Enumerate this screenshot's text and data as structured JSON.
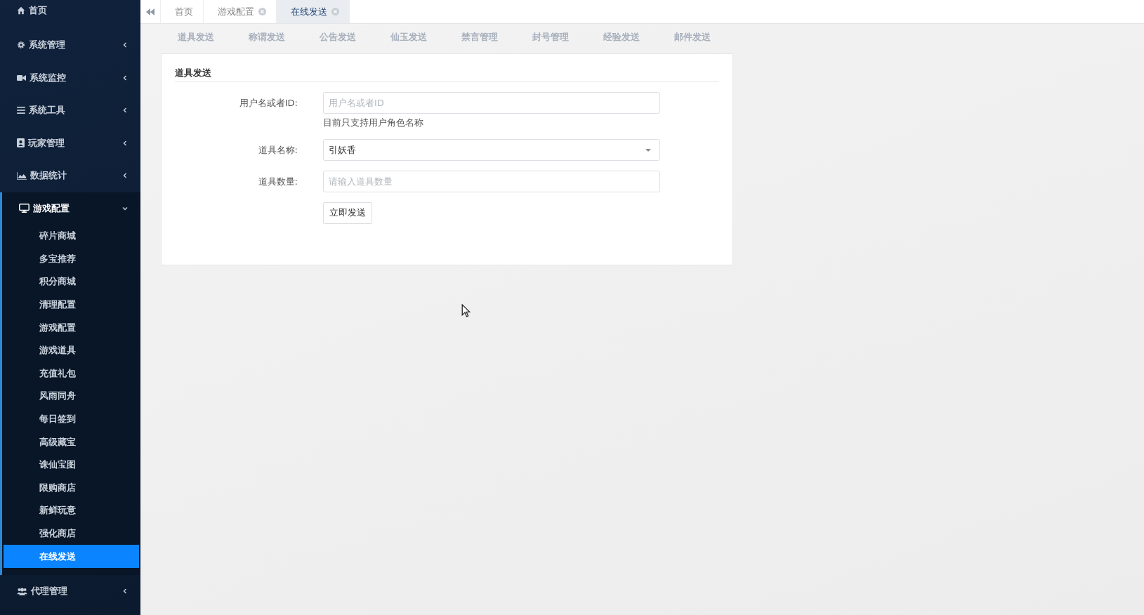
{
  "sidebar": {
    "home": {
      "label": "首页"
    },
    "groups": [
      {
        "label": "系统管理",
        "expanded": false
      },
      {
        "label": "系统监控",
        "expanded": false
      },
      {
        "label": "系统工具",
        "expanded": false
      },
      {
        "label": "玩家管理",
        "expanded": false
      },
      {
        "label": "数据统计",
        "expanded": false
      },
      {
        "label": "游戏配置",
        "expanded": true,
        "children": [
          {
            "label": "碎片商城",
            "selected": false
          },
          {
            "label": "多宝推荐",
            "selected": false
          },
          {
            "label": "积分商城",
            "selected": false
          },
          {
            "label": "清理配置",
            "selected": false
          },
          {
            "label": "游戏配置",
            "selected": false
          },
          {
            "label": "游戏道具",
            "selected": false
          },
          {
            "label": "充值礼包",
            "selected": false
          },
          {
            "label": "风雨同舟",
            "selected": false
          },
          {
            "label": "每日签到",
            "selected": false
          },
          {
            "label": "高级藏宝",
            "selected": false
          },
          {
            "label": "诛仙宝图",
            "selected": false
          },
          {
            "label": "限购商店",
            "selected": false
          },
          {
            "label": "新鲜玩意",
            "selected": false
          },
          {
            "label": "强化商店",
            "selected": false
          },
          {
            "label": "在线发送",
            "selected": true
          }
        ]
      },
      {
        "label": "代理管理",
        "expanded": false
      }
    ]
  },
  "tabs": [
    {
      "label": "首页",
      "closable": false,
      "selected": false
    },
    {
      "label": "游戏配置",
      "closable": true,
      "selected": false
    },
    {
      "label": "在线发送",
      "closable": true,
      "selected": true
    }
  ],
  "sub_tabs": [
    {
      "label": "道具发送",
      "selected": false
    },
    {
      "label": "称谓发送",
      "selected": false
    },
    {
      "label": "公告发送",
      "selected": false
    },
    {
      "label": "仙玉发送",
      "selected": false
    },
    {
      "label": "禁言管理",
      "selected": false
    },
    {
      "label": "封号管理",
      "selected": false
    },
    {
      "label": "经验发送",
      "selected": false
    },
    {
      "label": "邮件发送",
      "selected": false
    }
  ],
  "form": {
    "title": "道具发送",
    "fields": [
      {
        "kind": "input",
        "label": "用户名或者ID:",
        "placeholder": "用户名或者ID",
        "help": "目前只支持用户角色名称"
      },
      {
        "kind": "select",
        "label": "道具名称:",
        "value": "引妖香"
      },
      {
        "kind": "input",
        "label": "道具数量:",
        "placeholder": "请输入道具数量"
      }
    ],
    "submit": "立即发送"
  }
}
